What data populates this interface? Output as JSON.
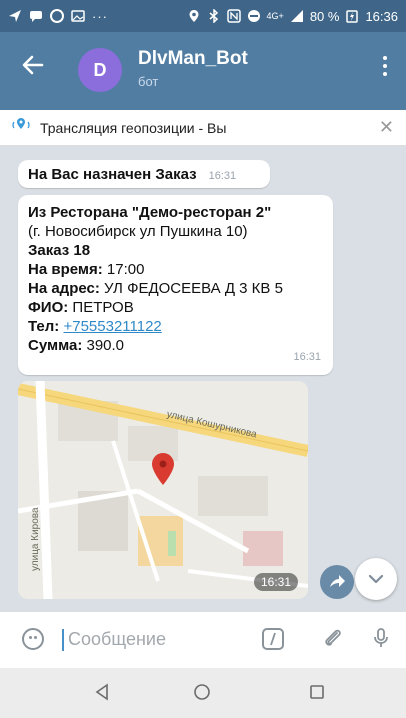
{
  "statusbar": {
    "network": "4G+",
    "battery": "80 %",
    "time": "16:36"
  },
  "appbar": {
    "avatar_letter": "D",
    "title": "DlvMan_Bot",
    "subtitle": "бот"
  },
  "banner": {
    "text": "Трансляция геопозиции - Вы"
  },
  "messages": {
    "m1": {
      "text": "На Вас назначен Заказ",
      "time": "16:31"
    },
    "m2": {
      "line1": "Из Ресторана \"Демо-ресторан 2\"",
      "line2": "(г. Новосибирск ул Пушкина 10)",
      "line3": "Заказ 18",
      "label_time": "На время:",
      "value_time": " 17:00",
      "label_address": "На адрес:",
      "value_address": " УЛ ФЕДОСЕЕВА Д 3 КВ 5",
      "label_fio": "ФИО:",
      "value_fio": " ПЕТРОВ",
      "label_phone": "Тел:",
      "value_phone": "+75553211122",
      "label_sum": "Сумма:",
      "value_sum": " 390.0",
      "time": "16:31"
    }
  },
  "map": {
    "street_top": "улица Кошурникова",
    "street_left": "улица Кирова",
    "time": "16:31"
  },
  "input": {
    "placeholder": "Сообщение"
  }
}
